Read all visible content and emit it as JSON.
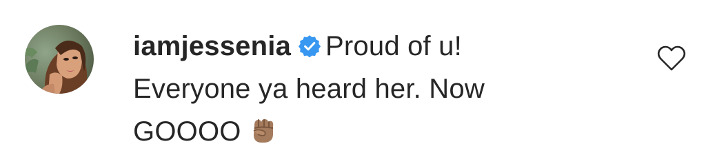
{
  "comment": {
    "username": "iamjessenia",
    "verified_icon": "verified-badge-icon",
    "text_line1": "Proud of u!",
    "text_line2": "Everyone ya heard her. Now",
    "text_line3": "GOOOO",
    "emoji": "raised-fist-icon",
    "like_icon": "heart-outline-icon",
    "colors": {
      "text": "#262626",
      "verified": "#3897f0",
      "fist": "#a47b5d"
    }
  }
}
